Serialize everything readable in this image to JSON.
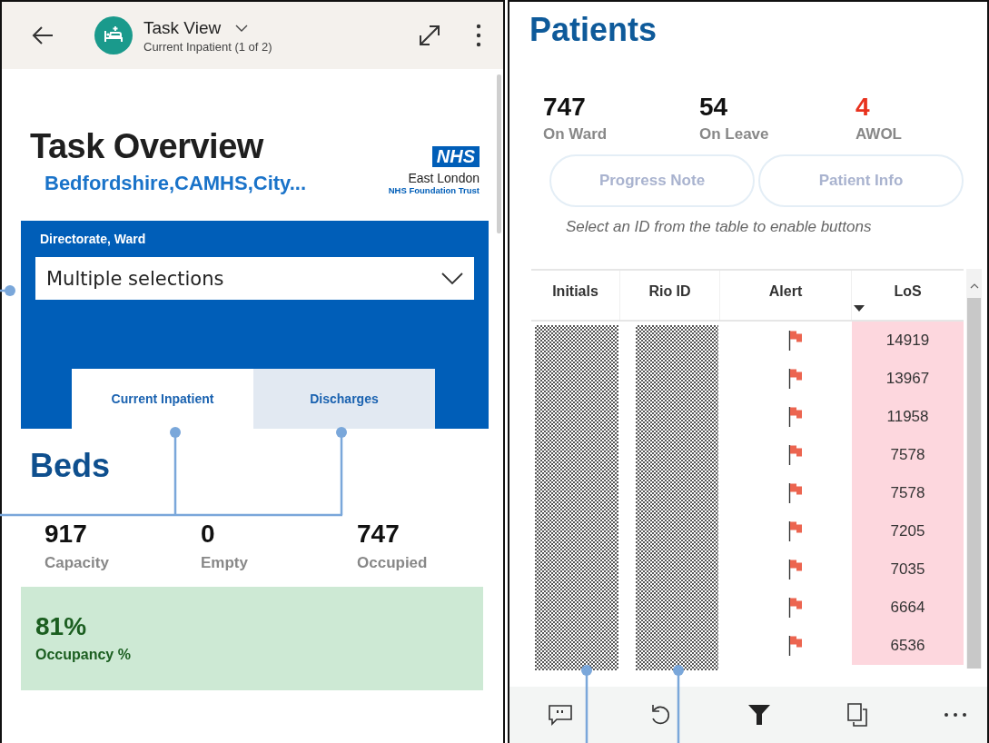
{
  "left_screen": {
    "app_bar": {
      "title": "Task View",
      "subtitle": "Current Inpatient (1 of 2)"
    },
    "header": {
      "title": "Task Overview",
      "subtitle": "Bedfordshire,CAMHS,City...",
      "logo": {
        "badge": "NHS",
        "name": "East London",
        "trust": "NHS Foundation Trust"
      }
    },
    "filter": {
      "label": "Directorate, Ward",
      "value": "Multiple selections"
    },
    "tabs": [
      {
        "label": "Current Inpatient",
        "selected": true
      },
      {
        "label": "Discharges",
        "selected": false
      }
    ],
    "section_title": "Beds",
    "stats": [
      {
        "value": "917",
        "label": "Capacity"
      },
      {
        "value": "0",
        "label": "Empty"
      },
      {
        "value": "747",
        "label": "Occupied"
      }
    ],
    "occupancy": {
      "value": "81%",
      "label": "Occupancy %"
    }
  },
  "right_screen": {
    "title": "Patients",
    "stats": [
      {
        "value": "747",
        "label": "On Ward",
        "color": "#111111"
      },
      {
        "value": "54",
        "label": "On Leave",
        "color": "#111111"
      },
      {
        "value": "4",
        "label": "AWOL",
        "color": "#e8321e"
      }
    ],
    "buttons": [
      {
        "label": "Progress Note",
        "disabled": true
      },
      {
        "label": "Patient Info",
        "disabled": true
      }
    ],
    "hint": "Select an ID from the table to enable buttons",
    "table": {
      "columns": [
        "Initials",
        "Rio ID",
        "Alert",
        "LoS"
      ],
      "rows": [
        {
          "alert": true,
          "los": "14919"
        },
        {
          "alert": true,
          "los": "13967"
        },
        {
          "alert": true,
          "los": "11958"
        },
        {
          "alert": true,
          "los": "7578"
        },
        {
          "alert": true,
          "los": "7578"
        },
        {
          "alert": true,
          "los": "7205"
        },
        {
          "alert": true,
          "los": "7035"
        },
        {
          "alert": true,
          "los": "6664"
        },
        {
          "alert": true,
          "los": "6536"
        }
      ]
    }
  }
}
